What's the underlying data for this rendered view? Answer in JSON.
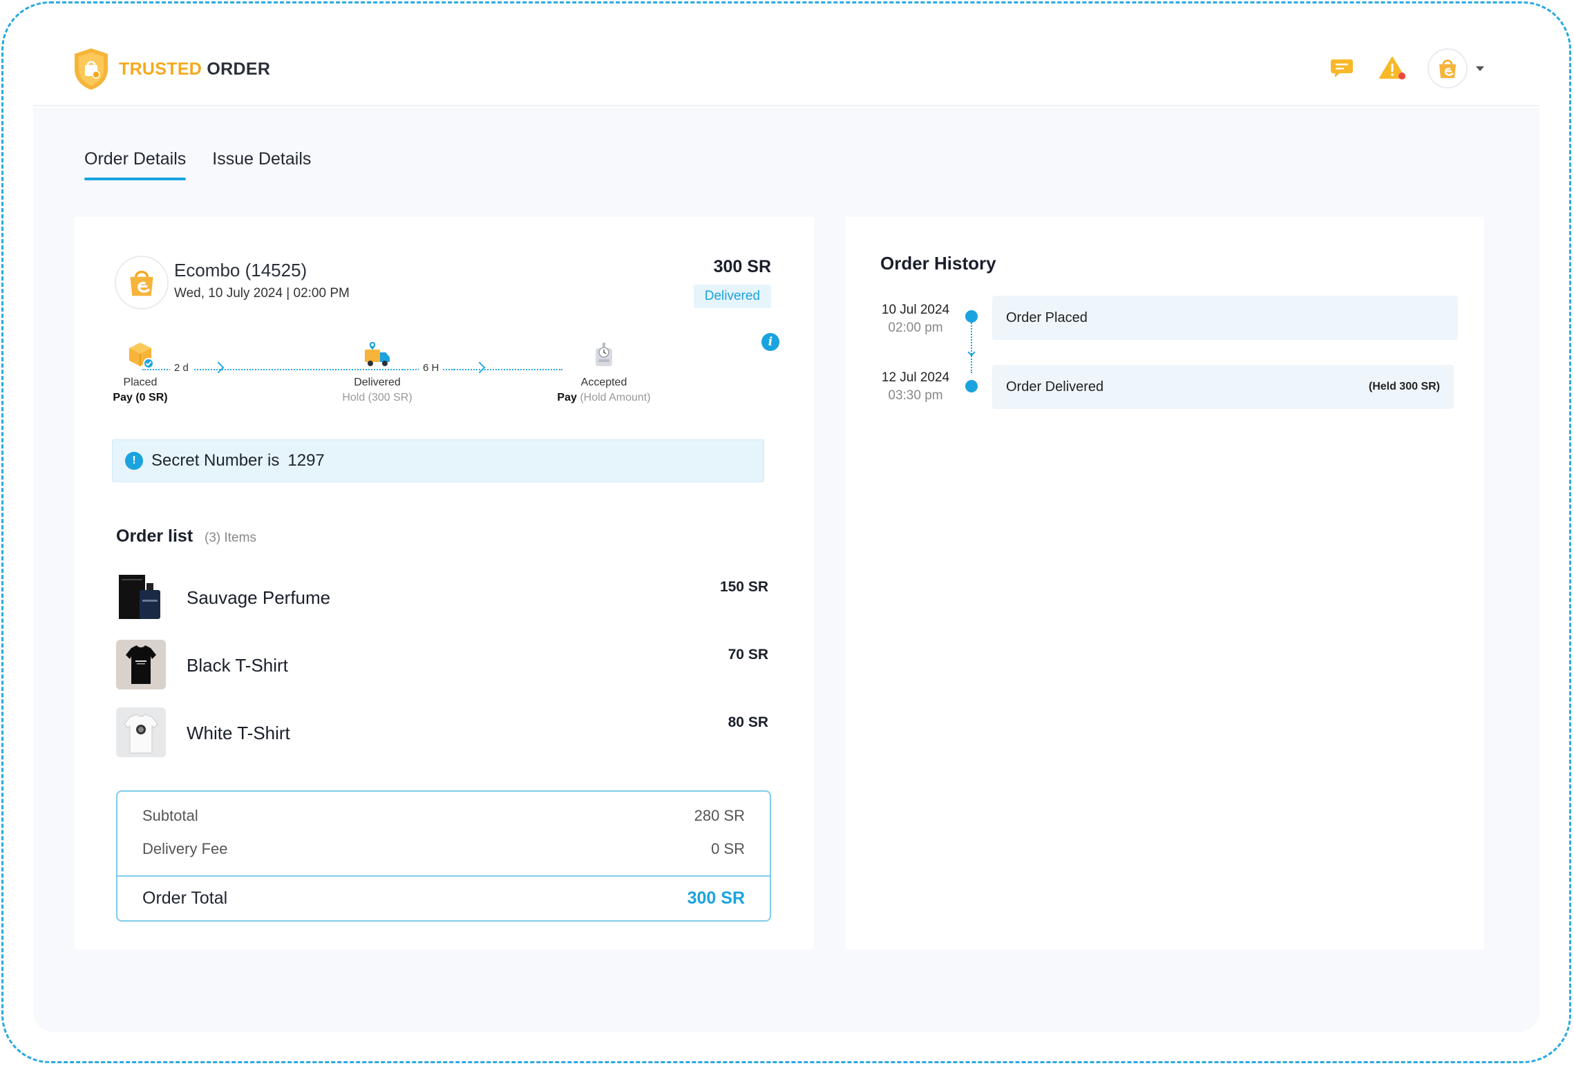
{
  "header": {
    "logo": {
      "word1": "TRUSTED",
      "word2": "ORDER"
    },
    "icons": [
      "chat-icon",
      "alert-icon",
      "avatar"
    ]
  },
  "tabs": [
    {
      "label": "Order Details",
      "active": true
    },
    {
      "label": "Issue Details",
      "active": false
    }
  ],
  "order": {
    "store_name": "Ecombo (14525)",
    "date": "Wed, 10 July 2024 | 02:00 PM",
    "total": "300 SR",
    "status": "Delivered"
  },
  "progress": {
    "steps": [
      {
        "label": "Placed",
        "sub_bold": "Pay",
        "sub": "(0 SR)",
        "icon": "box-check-icon"
      },
      {
        "label": "Delivered",
        "sub_bold": "",
        "sub": "Hold (300 SR)",
        "icon": "delivery-truck-icon"
      },
      {
        "label": "Accepted",
        "sub_bold": "Pay",
        "sub": "(Hold Amount)",
        "icon": "robot-icon"
      }
    ],
    "durations": [
      "2 d",
      "6 H"
    ]
  },
  "secret": {
    "text": "Secret Number is",
    "number": "1297"
  },
  "order_list": {
    "title": "Order list",
    "count": "(3) Items",
    "items": [
      {
        "name": "Sauvage Perfume",
        "price": "150 SR"
      },
      {
        "name": "Black T-Shirt",
        "price": "70 SR"
      },
      {
        "name": "White T-Shirt",
        "price": "80 SR"
      }
    ]
  },
  "summary": {
    "subtotal_label": "Subtotal",
    "subtotal_value": "280 SR",
    "delivery_label": "Delivery Fee",
    "delivery_value": "0 SR",
    "total_label": "Order Total",
    "total_value": "300 SR"
  },
  "history": {
    "title": "Order History",
    "events": [
      {
        "date": "10 Jul 2024",
        "time": "02:00 pm",
        "label": "Order Placed",
        "note": ""
      },
      {
        "date": "12 Jul 2024",
        "time": "03:30 pm",
        "label": "Order Delivered",
        "note": "(Held 300 SR)"
      }
    ]
  },
  "colors": {
    "accent": "#1aa3df",
    "brand": "#f6a81c",
    "background": "#f7f9fc"
  }
}
